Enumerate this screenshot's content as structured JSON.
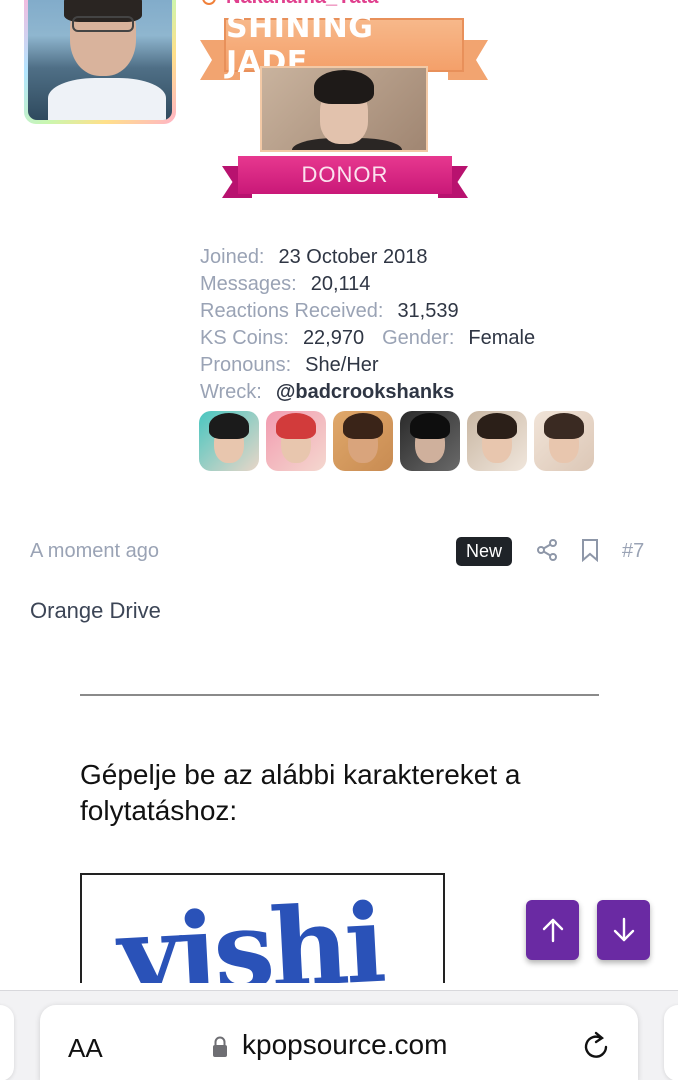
{
  "profile": {
    "username": "Nakahama_Yata",
    "banner_title": "SHINING JADE",
    "banner_badge": "DONOR"
  },
  "stats": {
    "joined_label": "Joined:",
    "joined_value": "23 October 2018",
    "messages_label": "Messages:",
    "messages_value": "20,114",
    "reactions_label": "Reactions Received:",
    "reactions_value": "31,539",
    "coins_label": "KS Coins:",
    "coins_value": "22,970",
    "gender_label": "Gender:",
    "gender_value": "Female",
    "pronouns_label": "Pronouns:",
    "pronouns_value": "She/Her",
    "wreck_label": "Wreck:",
    "wreck_value": "@badcrookshanks"
  },
  "post": {
    "timestamp": "A moment ago",
    "new_badge": "New",
    "post_number": "#7",
    "body": "Orange Drive",
    "captcha_prompt": "Gépelje be az alábbi karaktereket a folytatáshoz:",
    "captcha_text": "yishi"
  },
  "browser": {
    "aa_label": "AA",
    "url": "kpopsource.com"
  },
  "icons": {
    "share": "share-icon",
    "bookmark": "bookmark-icon",
    "scroll_up": "arrow-up-icon",
    "scroll_down": "arrow-down-icon",
    "lock": "lock-icon",
    "reload": "reload-icon"
  },
  "colors": {
    "accent_purple": "#6a2aa3",
    "username_pink": "#e0408e",
    "label_gray": "#9aa3b5"
  }
}
